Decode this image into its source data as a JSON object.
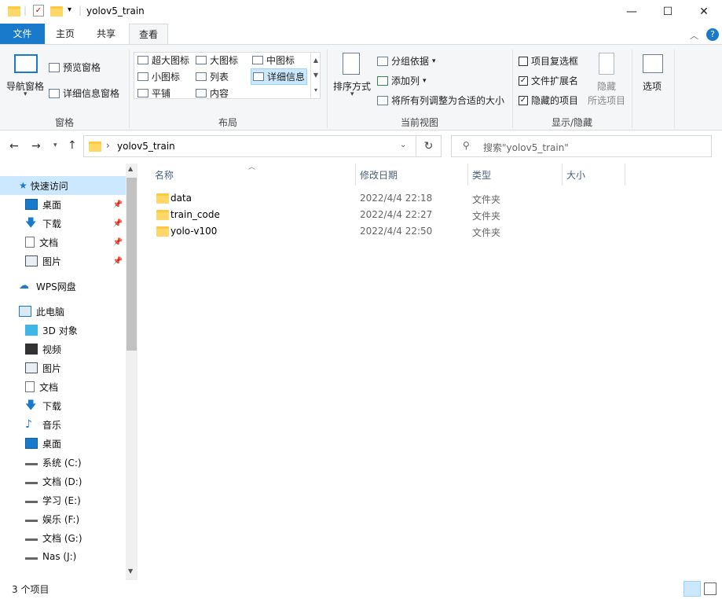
{
  "window": {
    "title": "yolov5_train",
    "minimize": "—",
    "maximize": "☐",
    "close": "✕"
  },
  "ribbon_tabs": [
    "文件",
    "主页",
    "共享",
    "查看"
  ],
  "ribbon": {
    "pane_group": {
      "label": "窗格",
      "nav_pane": "导航窗格",
      "preview_pane": "预览窗格",
      "details_pane": "详细信息窗格"
    },
    "layout_group": {
      "label": "布局",
      "items": [
        "超大图标",
        "大图标",
        "中图标",
        "小图标",
        "列表",
        "详细信息",
        "平铺",
        "内容"
      ],
      "selected": "详细信息"
    },
    "current_view_group": {
      "label": "当前视图",
      "sort_by": "排序方式",
      "group_by": "分组依据",
      "add_column": "添加列",
      "size_all_columns": "将所有列调整为合适的大小"
    },
    "show_hide_group": {
      "label": "显示/隐藏",
      "item_checkboxes": {
        "label": "项目复选框",
        "checked": false
      },
      "file_extensions": {
        "label": "文件扩展名",
        "checked": true
      },
      "hidden_items": {
        "label": "隐藏的项目",
        "checked": true
      },
      "hide_selected": "隐藏",
      "hide_selected_sub": "所选项目"
    },
    "options": "选项"
  },
  "address": {
    "path": "yolov5_train",
    "search_placeholder": "搜索\"yolov5_train\""
  },
  "sidebar": {
    "quick_access": "快速访问",
    "quick_items": [
      "桌面",
      "下载",
      "文档",
      "图片"
    ],
    "wps": "WPS网盘",
    "this_pc": "此电脑",
    "pc_items": [
      "3D 对象",
      "视频",
      "图片",
      "文档",
      "下载",
      "音乐",
      "桌面",
      "系统 (C:)",
      "文档 (D:)",
      "学习 (E:)",
      "娱乐 (F:)",
      "文档 (G:)",
      "Nas (J:)"
    ]
  },
  "columns": [
    "名称",
    "修改日期",
    "类型",
    "大小"
  ],
  "files": [
    {
      "name": "data",
      "date": "2022/4/4 22:18",
      "type": "文件夹",
      "size": ""
    },
    {
      "name": "train_code",
      "date": "2022/4/4 22:27",
      "type": "文件夹",
      "size": ""
    },
    {
      "name": "yolo-v100",
      "date": "2022/4/4 22:50",
      "type": "文件夹",
      "size": ""
    }
  ],
  "status": "3 个项目",
  "colors": {
    "file_tab": "#1979ca",
    "ribbon_bg": "#f5f6f7",
    "selected_nav": "#cce8ff",
    "folder": "#ffd766"
  }
}
